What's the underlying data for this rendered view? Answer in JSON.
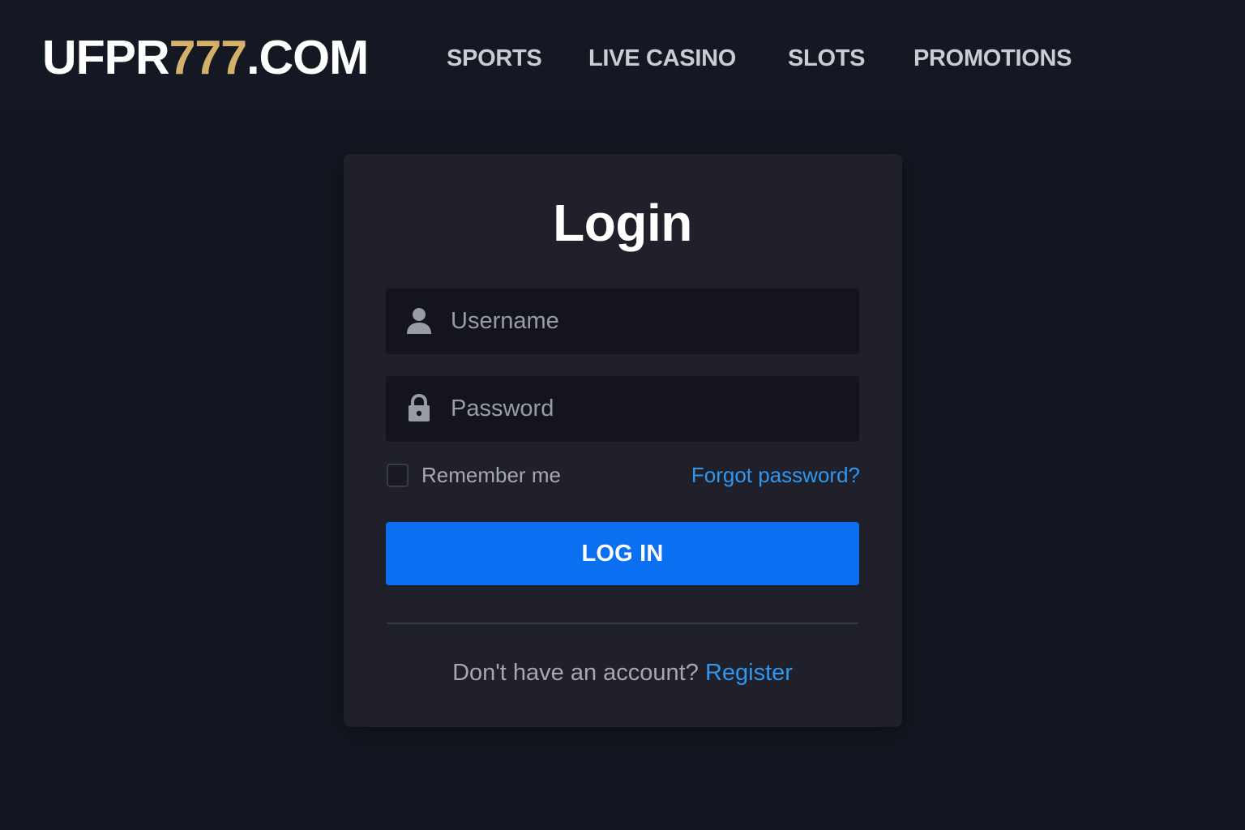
{
  "header": {
    "logo": {
      "prefix": "UFPR",
      "accent": "777",
      "suffix": ".COM"
    },
    "nav": [
      {
        "label": "SPORTS"
      },
      {
        "label": "LIVE CASINO"
      },
      {
        "label": "SLOTS"
      },
      {
        "label": "PROMOTIONS"
      }
    ]
  },
  "login": {
    "title": "Login",
    "username": {
      "placeholder": "Username",
      "value": "",
      "icon": "user-icon"
    },
    "password": {
      "placeholder": "Password",
      "value": "",
      "icon": "lock-icon"
    },
    "remember_label": "Remember me",
    "remember_checked": false,
    "forgot_label": "Forgot password?",
    "submit_label": "LOG IN",
    "register_prompt": "Don't have an account?",
    "register_label": "Register"
  },
  "colors": {
    "background": "#131620",
    "card": "#1f2029",
    "accent_gold": "#d4b06a",
    "primary_button": "#0a6ff0",
    "link": "#2f97f0"
  }
}
